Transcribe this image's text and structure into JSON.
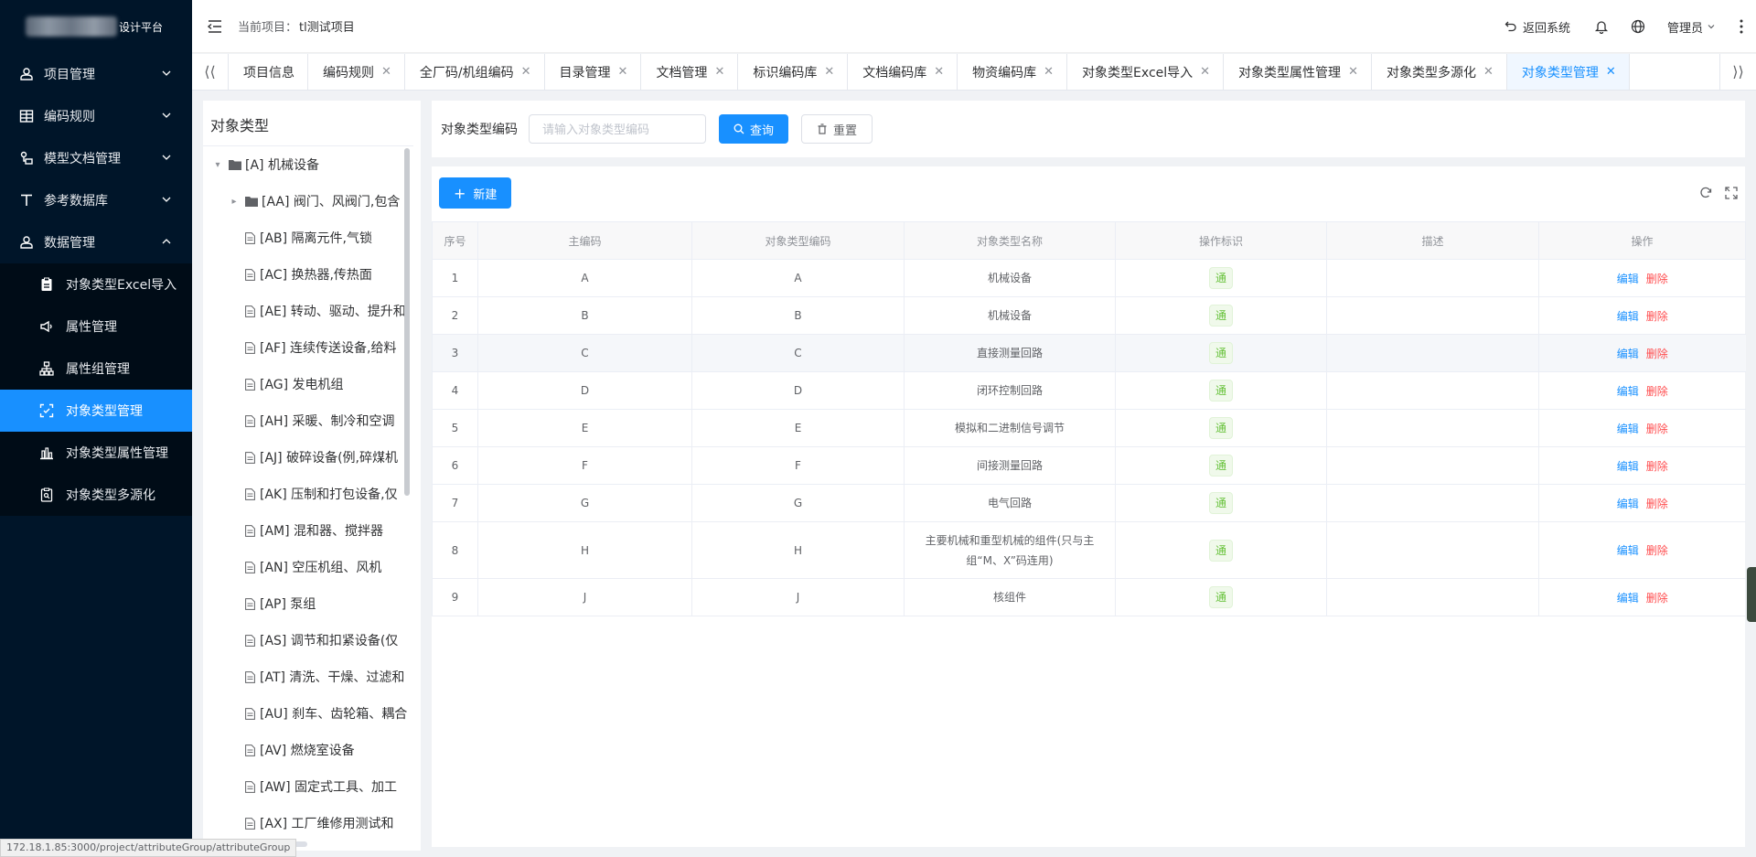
{
  "sidebar": {
    "logo_text": "设计平台",
    "menu": [
      {
        "label": "项目管理"
      },
      {
        "label": "编码规则"
      },
      {
        "label": "模型文档管理"
      },
      {
        "label": "参考数据库"
      },
      {
        "label": "数据管理"
      }
    ],
    "submenu": [
      {
        "label": "对象类型Excel导入"
      },
      {
        "label": "属性管理"
      },
      {
        "label": "属性组管理"
      },
      {
        "label": "对象类型管理",
        "active": true
      },
      {
        "label": "对象类型属性管理"
      },
      {
        "label": "对象类型多源化"
      }
    ]
  },
  "header": {
    "project_label": "当前项目：",
    "project_name": "tl测试项目",
    "back_label": "返回系统",
    "user_label": "管理员"
  },
  "tabs": [
    {
      "label": "项目信息",
      "closable": false
    },
    {
      "label": "编码规则",
      "closable": true
    },
    {
      "label": "全厂码/机组编码",
      "closable": true
    },
    {
      "label": "目录管理",
      "closable": true
    },
    {
      "label": "文档管理",
      "closable": true
    },
    {
      "label": "标识编码库",
      "closable": true
    },
    {
      "label": "文档编码库",
      "closable": true
    },
    {
      "label": "物资编码库",
      "closable": true
    },
    {
      "label": "对象类型Excel导入",
      "closable": true
    },
    {
      "label": "对象类型属性管理",
      "closable": true
    },
    {
      "label": "对象类型多源化",
      "closable": true
    },
    {
      "label": "对象类型管理",
      "closable": true,
      "active": true
    }
  ],
  "tree": {
    "title": "对象类型",
    "nodes": [
      {
        "label": "[A] 机械设备",
        "type": "folder-open",
        "level": 0
      },
      {
        "label": "[AA] 阀门、风阀门,包含",
        "type": "folder",
        "level": 1
      },
      {
        "label": "[AB] 隔离元件,气锁",
        "type": "doc",
        "level": 1
      },
      {
        "label": "[AC] 换热器,传热面",
        "type": "doc",
        "level": 1
      },
      {
        "label": "[AE] 转动、驱动、提升和",
        "type": "doc",
        "level": 1
      },
      {
        "label": "[AF] 连续传送设备,给料",
        "type": "doc",
        "level": 1
      },
      {
        "label": "[AG] 发电机组",
        "type": "doc",
        "level": 1
      },
      {
        "label": "[AH] 采暖、制冷和空调",
        "type": "doc",
        "level": 1
      },
      {
        "label": "[AJ] 破碎设备(例,碎煤机",
        "type": "doc",
        "level": 1
      },
      {
        "label": "[AK] 压制和打包设备,仅",
        "type": "doc",
        "level": 1
      },
      {
        "label": "[AM] 混和器、搅拌器",
        "type": "doc",
        "level": 1
      },
      {
        "label": "[AN] 空压机组、风机",
        "type": "doc",
        "level": 1
      },
      {
        "label": "[AP] 泵组",
        "type": "doc",
        "level": 1
      },
      {
        "label": "[AS] 调节和扣紧设备(仅",
        "type": "doc",
        "level": 1
      },
      {
        "label": "[AT] 清洗、干燥、过滤和",
        "type": "doc",
        "level": 1
      },
      {
        "label": "[AU] 刹车、齿轮箱、耦合",
        "type": "doc",
        "level": 1
      },
      {
        "label": "[AV] 燃烧室设备",
        "type": "doc",
        "level": 1
      },
      {
        "label": "[AW] 固定式工具、加工",
        "type": "doc",
        "level": 1
      },
      {
        "label": "[AX] 工厂维修用测试和",
        "type": "doc",
        "level": 1
      }
    ]
  },
  "search": {
    "label": "对象类型编码",
    "placeholder": "请输入对象类型编码",
    "query_label": "查询",
    "reset_label": "重置"
  },
  "table": {
    "new_label": "新建",
    "columns": [
      "序号",
      "主编码",
      "对象类型编码",
      "对象类型名称",
      "操作标识",
      "描述",
      "操作"
    ],
    "rows": [
      {
        "no": "1",
        "main": "A",
        "code": "A",
        "name": "机械设备",
        "flag": "通",
        "desc": ""
      },
      {
        "no": "2",
        "main": "B",
        "code": "B",
        "name": "机械设备",
        "flag": "通",
        "desc": ""
      },
      {
        "no": "3",
        "main": "C",
        "code": "C",
        "name": "直接测量回路",
        "flag": "通",
        "desc": ""
      },
      {
        "no": "4",
        "main": "D",
        "code": "D",
        "name": "闭环控制回路",
        "flag": "通",
        "desc": ""
      },
      {
        "no": "5",
        "main": "E",
        "code": "E",
        "name": "模拟和二进制信号调节",
        "flag": "通",
        "desc": ""
      },
      {
        "no": "6",
        "main": "F",
        "code": "F",
        "name": "间接测量回路",
        "flag": "通",
        "desc": ""
      },
      {
        "no": "7",
        "main": "G",
        "code": "G",
        "name": "电气回路",
        "flag": "通",
        "desc": ""
      },
      {
        "no": "8",
        "main": "H",
        "code": "H",
        "name": "主要机械和重型机械的组件(只与主组“M、X”码连用)",
        "flag": "通",
        "desc": ""
      },
      {
        "no": "9",
        "main": "J",
        "code": "J",
        "name": "核组件",
        "flag": "通",
        "desc": ""
      }
    ],
    "edit_label": "编辑",
    "delete_label": "删除"
  },
  "status_url": "172.18.1.85:3000/project/attributeGroup/attributeGroup",
  "colors": {
    "sidebar_bg": "#001529",
    "accent": "#1890ff",
    "danger": "#ff4d4f",
    "tag_green": "#67c23a"
  }
}
